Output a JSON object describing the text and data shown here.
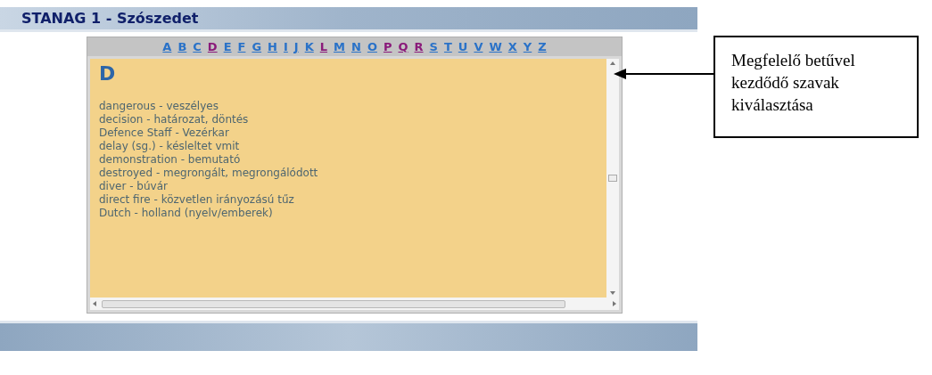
{
  "header": {
    "title": "STANAG 1 - Szószedet"
  },
  "letters": [
    {
      "label": "A",
      "visited": false
    },
    {
      "label": "B",
      "visited": false
    },
    {
      "label": "C",
      "visited": false
    },
    {
      "label": "D",
      "visited": true
    },
    {
      "label": "E",
      "visited": false
    },
    {
      "label": "F",
      "visited": false
    },
    {
      "label": "G",
      "visited": false
    },
    {
      "label": "H",
      "visited": false
    },
    {
      "label": "I",
      "visited": false
    },
    {
      "label": "J",
      "visited": false
    },
    {
      "label": "K",
      "visited": false
    },
    {
      "label": "L",
      "visited": true
    },
    {
      "label": "M",
      "visited": false
    },
    {
      "label": "N",
      "visited": false
    },
    {
      "label": "O",
      "visited": false
    },
    {
      "label": "P",
      "visited": true
    },
    {
      "label": "Q",
      "visited": true
    },
    {
      "label": "R",
      "visited": true
    },
    {
      "label": "S",
      "visited": false
    },
    {
      "label": "T",
      "visited": false
    },
    {
      "label": "U",
      "visited": false
    },
    {
      "label": "V",
      "visited": false
    },
    {
      "label": "W",
      "visited": false
    },
    {
      "label": "X",
      "visited": false
    },
    {
      "label": "Y",
      "visited": false
    },
    {
      "label": "Z",
      "visited": false
    }
  ],
  "content": {
    "heading": "D",
    "entries": [
      "dangerous - veszélyes",
      "decision - határozat, döntés",
      "Defence Staff - Vezérkar",
      "delay (sg.) - késleltet vmit",
      "demonstration - bemutató",
      "destroyed - megrongált, megrongálódott",
      "diver - búvár",
      "direct fire - közvetlen irányozású tűz",
      "Dutch - holland (nyelv/emberek)"
    ]
  },
  "callout": {
    "text": "Megfelelő betűvel kezdődő szavak kiválasztása"
  }
}
